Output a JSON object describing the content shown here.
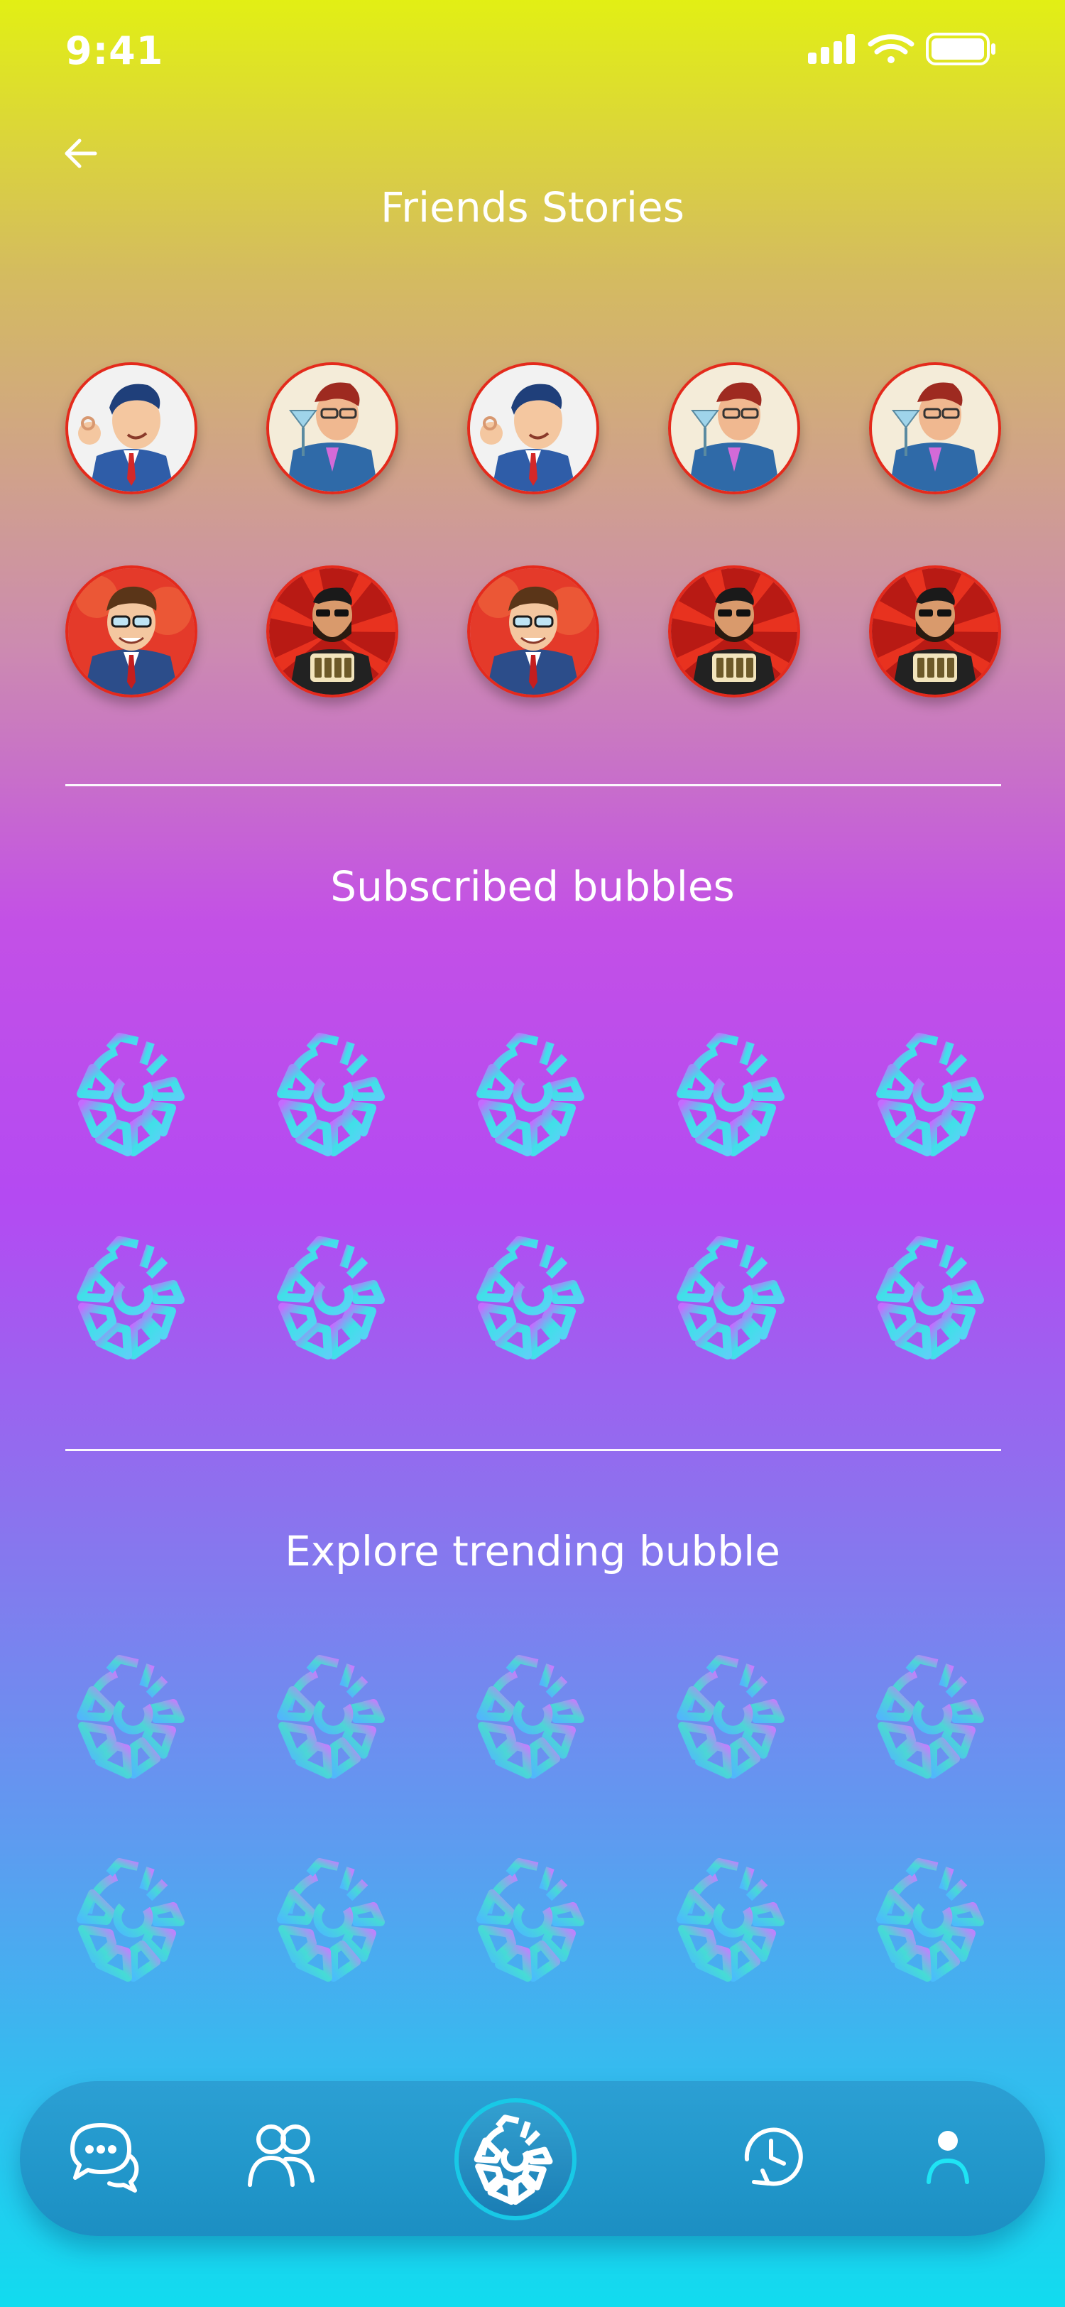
{
  "status": {
    "time": "9:41"
  },
  "header": {
    "title": "Friends Stories"
  },
  "sections": {
    "subscribed_title": "Subscribed bubbles",
    "explore_title": "Explore trending bubble"
  },
  "friends": {
    "row1": [
      "retro-man-ok-gesture",
      "retro-man-cocktail",
      "retro-man-ok-gesture",
      "retro-man-cocktail",
      "retro-man-cocktail"
    ],
    "row2": [
      "retro-man-glasses",
      "bearded-man-money",
      "retro-man-glasses",
      "bearded-man-money",
      "bearded-man-money"
    ]
  },
  "colors": {
    "avatar_border": "#e42a1c",
    "accent": "#18c9e6",
    "white": "#ffffff"
  },
  "icons": {
    "back": "arrow-left-icon",
    "bubble": "bubble-logo-icon",
    "nav": [
      "chat-bubbles-icon",
      "friends-icon",
      "bubble-logo-icon",
      "history-clock-icon",
      "profile-icon"
    ]
  }
}
